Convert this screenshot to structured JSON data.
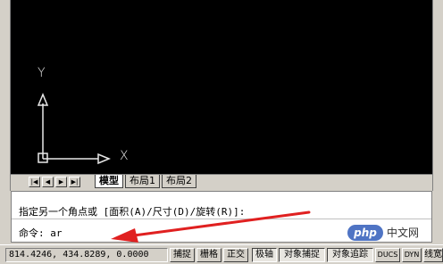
{
  "colors": {
    "canvas": "#000000",
    "annotation_arrow": "#e02020",
    "watermark_blue": "#4f74c4"
  },
  "ucs": {
    "y_label": "Y",
    "x_label": "X"
  },
  "tabs": {
    "nav": [
      "|◀",
      "◀",
      "▶",
      "▶|"
    ],
    "items": [
      {
        "label": "模型",
        "active": true
      },
      {
        "label": "布局1",
        "active": false
      },
      {
        "label": "布局2",
        "active": false
      }
    ]
  },
  "command": {
    "history_line": "指定另一个角点或 [面积(A)/尺寸(D)/旋转(R)]:",
    "prompt_line": "命令: ar"
  },
  "status": {
    "coordinates": "814.4246, 434.8289, 0.0000",
    "buttons": [
      "捕捉",
      "栅格",
      "正交",
      "极轴",
      "对象捕捉",
      "对象追踪",
      "DUCS",
      "DYN",
      "线宽"
    ]
  },
  "watermark": {
    "logo": "php",
    "text": "中文网"
  }
}
